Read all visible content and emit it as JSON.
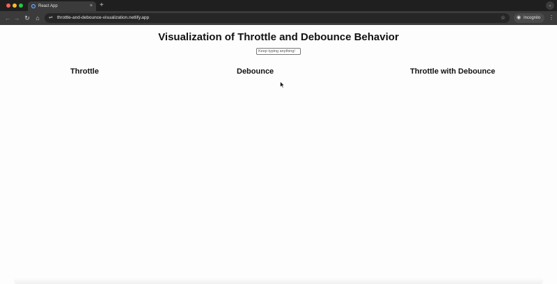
{
  "browser": {
    "tab": {
      "title": "React App",
      "close_glyph": "×",
      "favicon": "globe-icon"
    },
    "new_tab_glyph": "+",
    "menu_glyph": "⌄",
    "toolbar": {
      "back_glyph": "←",
      "forward_glyph": "→",
      "reload_glyph": "↻",
      "home_glyph": "⌂",
      "site_info_glyph": "⇌",
      "url": "throttle-and-debounce-visualization.netlify.app",
      "star_glyph": "☆",
      "incognito_label": "Incognito",
      "incognito_glyph": "◉",
      "kebab_glyph": "⋮"
    }
  },
  "page": {
    "title": "Visualization of Throttle and Debounce Behavior",
    "input": {
      "placeholder": "Keep typing anything!",
      "value": ""
    },
    "columns": [
      {
        "heading": "Throttle"
      },
      {
        "heading": "Debounce"
      },
      {
        "heading": "Throttle with Debounce"
      }
    ]
  },
  "colors": {
    "tabbar_bg": "#1f1f1f",
    "toolbar_bg": "#3b3b3b",
    "omnibox_bg": "#262626",
    "page_bg": "#fdfdfd",
    "text": "#111111"
  }
}
